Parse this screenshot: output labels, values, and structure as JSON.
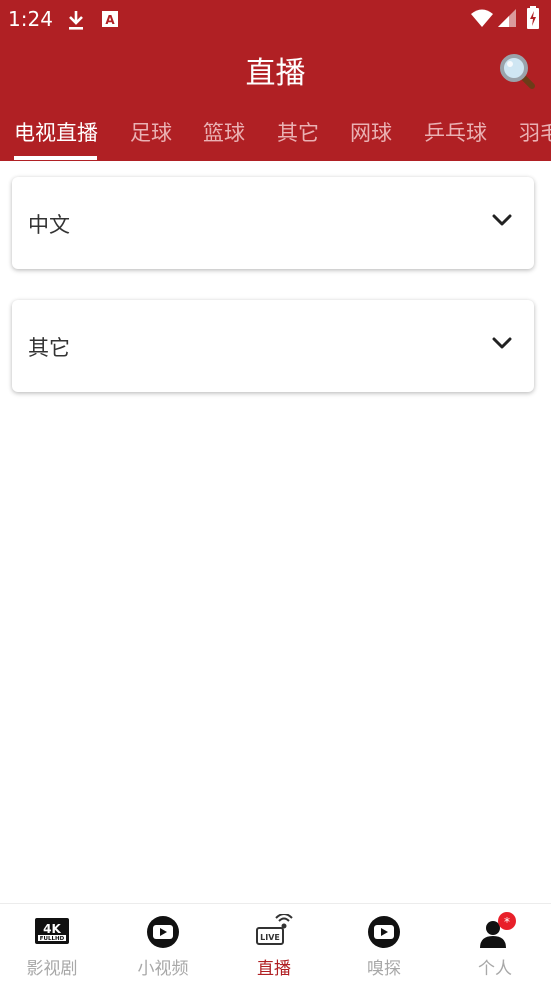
{
  "status_bar": {
    "time": "1:24",
    "icons": [
      "download-icon",
      "a-notification-icon",
      "wifi-icon",
      "signal-icon",
      "battery-charging-icon"
    ]
  },
  "app_bar": {
    "title": "直播",
    "search_icon": "search-icon"
  },
  "tabs": [
    {
      "label": "电视直播",
      "active": true
    },
    {
      "label": "足球",
      "active": false
    },
    {
      "label": "篮球",
      "active": false
    },
    {
      "label": "其它",
      "active": false
    },
    {
      "label": "网球",
      "active": false
    },
    {
      "label": "乒乓球",
      "active": false
    },
    {
      "label": "羽毛",
      "active": false
    }
  ],
  "sections": [
    {
      "label": "中文",
      "icon": "chevron-down-icon"
    },
    {
      "label": "其它",
      "icon": "chevron-down-icon"
    }
  ],
  "bottom_nav": [
    {
      "label": "影视剧",
      "icon": "4k-fullhd-icon",
      "active": false
    },
    {
      "label": "小视频",
      "icon": "play-circle-icon",
      "active": false
    },
    {
      "label": "直播",
      "icon": "live-broadcast-icon",
      "active": true
    },
    {
      "label": "嗅探",
      "icon": "play-circle-icon",
      "active": false
    },
    {
      "label": "个人",
      "icon": "user-icon",
      "active": false,
      "badge": "*"
    }
  ],
  "colors": {
    "primary": "#b02024",
    "tab_inactive": "#eab1b3",
    "nav_inactive": "#a8a8a8"
  }
}
